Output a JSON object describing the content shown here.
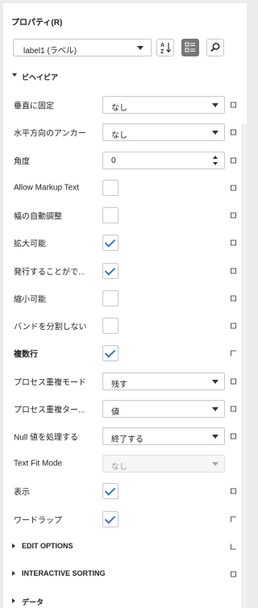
{
  "panel": {
    "title": "プロパティ(R)"
  },
  "selector": {
    "value": "label1 (ラベル)"
  },
  "toolbar": {
    "sort_icon": "sort-az-icon",
    "category_icon": "category-grid-icon",
    "search_icon": "search-icon"
  },
  "sections": {
    "behavior": "ビヘイビア",
    "edit_options": "EDIT OPTIONS",
    "interactive_sorting": "INTERACTIVE SORTING",
    "data": "データ"
  },
  "rows": {
    "r0": {
      "label": "垂直に固定",
      "value": "なし"
    },
    "r1": {
      "label": "水平方向のアンカー",
      "value": "なし"
    },
    "r2": {
      "label": "角度",
      "value": "0"
    },
    "r3": {
      "label": "Allow Markup Text",
      "checked": false
    },
    "r4": {
      "label": "幅の自動調整",
      "checked": false
    },
    "r5": {
      "label": "拡大可能",
      "checked": true
    },
    "r6": {
      "label": "発行することがで...",
      "checked": true
    },
    "r7": {
      "label": "縮小可能",
      "checked": false
    },
    "r8": {
      "label": "バンドを分割しない",
      "checked": false
    },
    "r9": {
      "label": "複数行",
      "checked": true
    },
    "r10": {
      "label": "プロセス重複モード",
      "value": "残す"
    },
    "r11": {
      "label": "プロセス重複ター...",
      "value": "値"
    },
    "r12": {
      "label": "Null 値を処理する",
      "value": "終了する"
    },
    "r13": {
      "label": "Text Fit Mode",
      "value": "なし"
    },
    "r14": {
      "label": "表示",
      "checked": true
    },
    "r15": {
      "label": "ワードラップ",
      "checked": true
    }
  },
  "colors": {
    "accent": "#3a77c4",
    "active_button": "#777777"
  }
}
